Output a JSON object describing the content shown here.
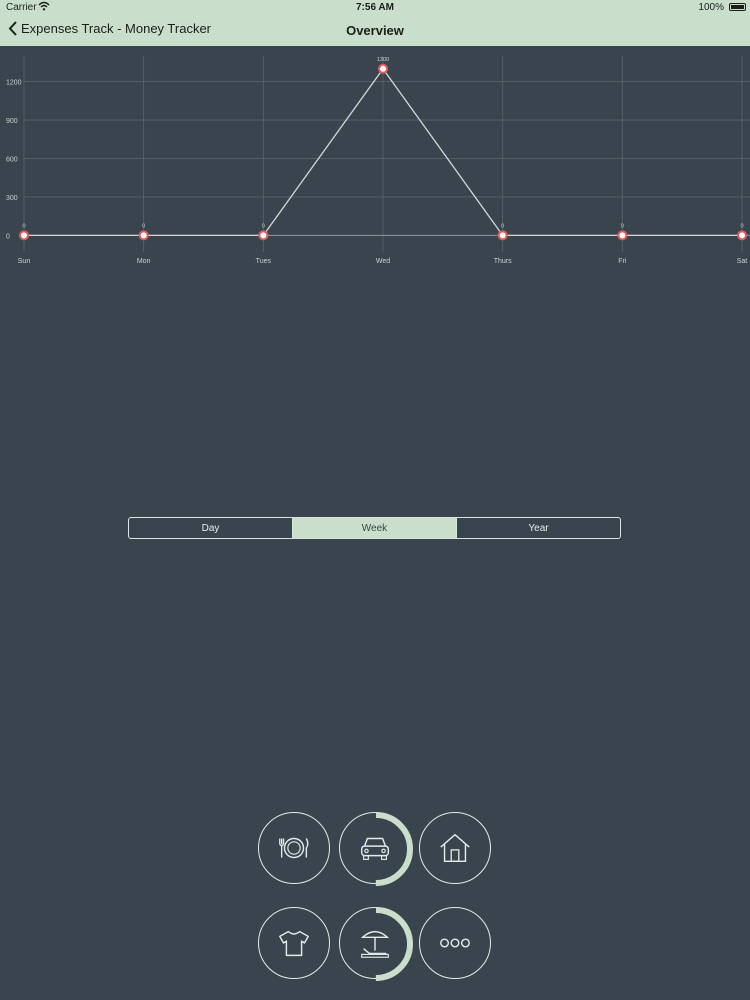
{
  "status_bar": {
    "carrier": "Carrier",
    "time": "7:56 AM",
    "battery": "100%"
  },
  "nav": {
    "back_label": "Expenses Track - Money Tracker",
    "title": "Overview"
  },
  "chart_data": {
    "type": "line",
    "categories": [
      "Sun",
      "Mon",
      "Tues",
      "Wed",
      "Thurs",
      "Fri",
      "Sat"
    ],
    "series": [
      {
        "values": [
          0,
          0,
          0,
          1300,
          0,
          0,
          0
        ]
      }
    ],
    "point_labels": [
      "0",
      "0",
      "0",
      "1300",
      "0",
      "0",
      "0"
    ],
    "yticks": [
      0,
      300,
      600,
      900,
      1200
    ],
    "ylim": [
      -130,
      1400
    ],
    "grid": true,
    "line_color": "#d2d9d4",
    "point_color": "#e35b5b"
  },
  "segments": {
    "items": [
      "Day",
      "Week",
      "Year"
    ],
    "selected": "Week"
  },
  "categories": [
    {
      "name": "food",
      "icon": "food-plate-icon",
      "progress": 0
    },
    {
      "name": "car",
      "icon": "car-icon",
      "progress": 0.5
    },
    {
      "name": "house",
      "icon": "house-icon",
      "progress": 0
    },
    {
      "name": "clothing",
      "icon": "tshirt-icon",
      "progress": 0
    },
    {
      "name": "leisure",
      "icon": "beach-umbrella-icon",
      "progress": 0.5
    },
    {
      "name": "more",
      "icon": "more-icon",
      "progress": 0
    }
  ],
  "colors": {
    "background": "#3a444e",
    "accent": "#c9dfcc"
  }
}
